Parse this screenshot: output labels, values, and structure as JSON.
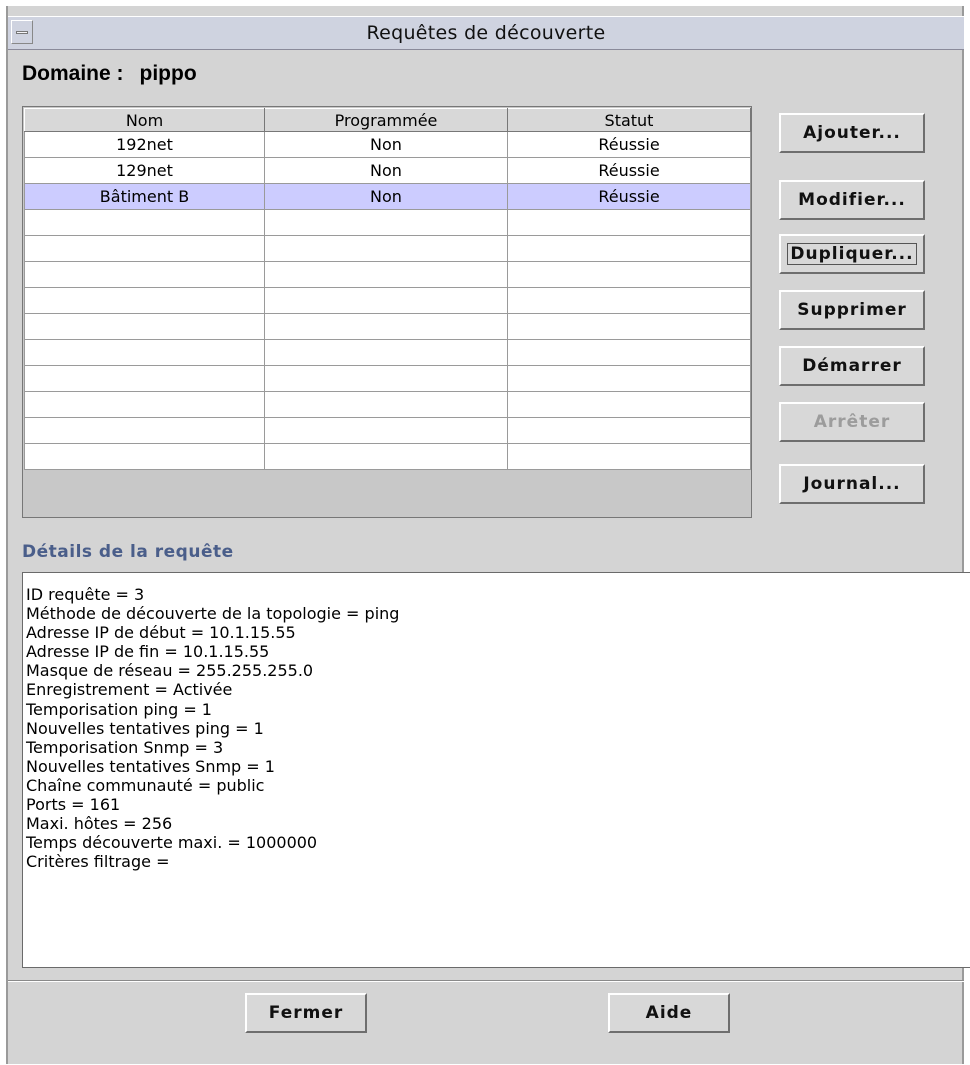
{
  "window": {
    "title": "Requêtes de découverte"
  },
  "domain": {
    "label": "Domaine :",
    "value": "pippo"
  },
  "table": {
    "columns": [
      "Nom",
      "Programmée",
      "Statut"
    ],
    "rows": [
      {
        "nom": "192net",
        "programmee": "Non",
        "statut": "Réussie",
        "selected": false
      },
      {
        "nom": "129net",
        "programmee": "Non",
        "statut": "Réussie",
        "selected": false
      },
      {
        "nom": "Bâtiment B",
        "programmee": "Non",
        "statut": "Réussie",
        "selected": true
      }
    ],
    "empty_rows": 10
  },
  "buttons": {
    "ajouter": "Ajouter...",
    "modifier": "Modifier...",
    "dupliquer": "Dupliquer...",
    "supprimer": "Supprimer",
    "demarrer": "Démarrer",
    "arreter": "Arrêter",
    "journal": "Journal...",
    "fermer": "Fermer",
    "aide": "Aide"
  },
  "details": {
    "title": "Détails de la requête",
    "lines": [
      "ID requête = 3",
      "Méthode de découverte de la topologie = ping",
      "Adresse IP de début = 10.1.15.55",
      "Adresse IP de fin = 10.1.15.55",
      "Masque de réseau = 255.255.255.0",
      "Enregistrement = Activée",
      "Temporisation ping = 1",
      "Nouvelles tentatives ping = 1",
      "Temporisation Snmp = 3",
      "Nouvelles tentatives Snmp = 1",
      "Chaîne communauté = public",
      "Ports = 161",
      "Maxi. hôtes = 256",
      "Temps découverte maxi. = 1000000",
      "Critères filtrage ="
    ]
  },
  "colors": {
    "selection": "#ccccff",
    "section_title": "#4a5e8a",
    "disabled_text": "#9c9c9c"
  }
}
